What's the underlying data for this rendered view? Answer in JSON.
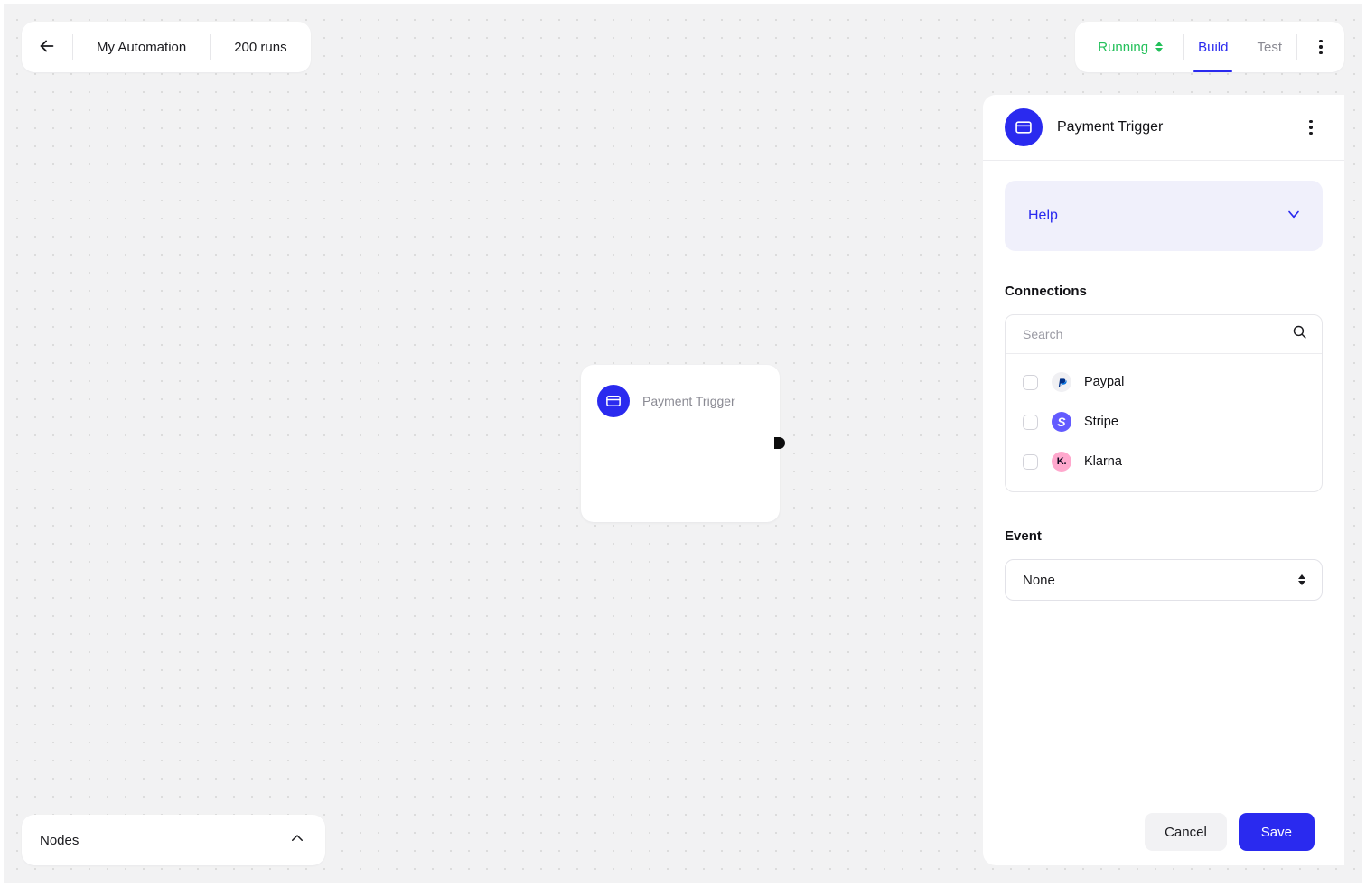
{
  "toolbar_left": {
    "back_icon": "arrow-left-icon",
    "automation_name": "My Automation",
    "runs_label": "200 runs"
  },
  "toolbar_right": {
    "status": "Running",
    "status_color": "#23c05a",
    "status_selector_icon": "chevron-updown-icon",
    "tabs": [
      {
        "label": "Build",
        "active": true
      },
      {
        "label": "Test",
        "active": false
      }
    ],
    "menu_icon": "kebab-menu-icon"
  },
  "canvas": {
    "node": {
      "icon": "credit-card-icon",
      "title": "Payment Trigger",
      "handle": "output-connector-handle"
    }
  },
  "nodes_panel": {
    "title": "Nodes",
    "collapse_icon": "chevron-up-icon"
  },
  "right_panel": {
    "header": {
      "icon": "credit-card-icon",
      "title": "Payment Trigger",
      "menu_icon": "kebab-menu-icon"
    },
    "help": {
      "label": "Help",
      "expand_icon": "chevron-down-icon"
    },
    "connections": {
      "title": "Connections",
      "search_placeholder": "Search",
      "search_value": "",
      "search_icon": "search-icon",
      "items": [
        {
          "name": "Paypal",
          "logo": "paypal-logo",
          "glyph": "P",
          "checked": false
        },
        {
          "name": "Stripe",
          "logo": "stripe-logo",
          "glyph": "S",
          "checked": false
        },
        {
          "name": "Klarna",
          "logo": "klarna-logo",
          "glyph": "K.",
          "checked": false
        }
      ]
    },
    "event": {
      "title": "Event",
      "selected": "None",
      "selector_icon": "chevron-updown-icon"
    },
    "footer": {
      "cancel_label": "Cancel",
      "save_label": "Save"
    }
  },
  "colors": {
    "accent": "#2a2aef",
    "status_running": "#23c05a",
    "help_bg": "#f0f0fb",
    "canvas_bg": "#f2f2f3"
  }
}
